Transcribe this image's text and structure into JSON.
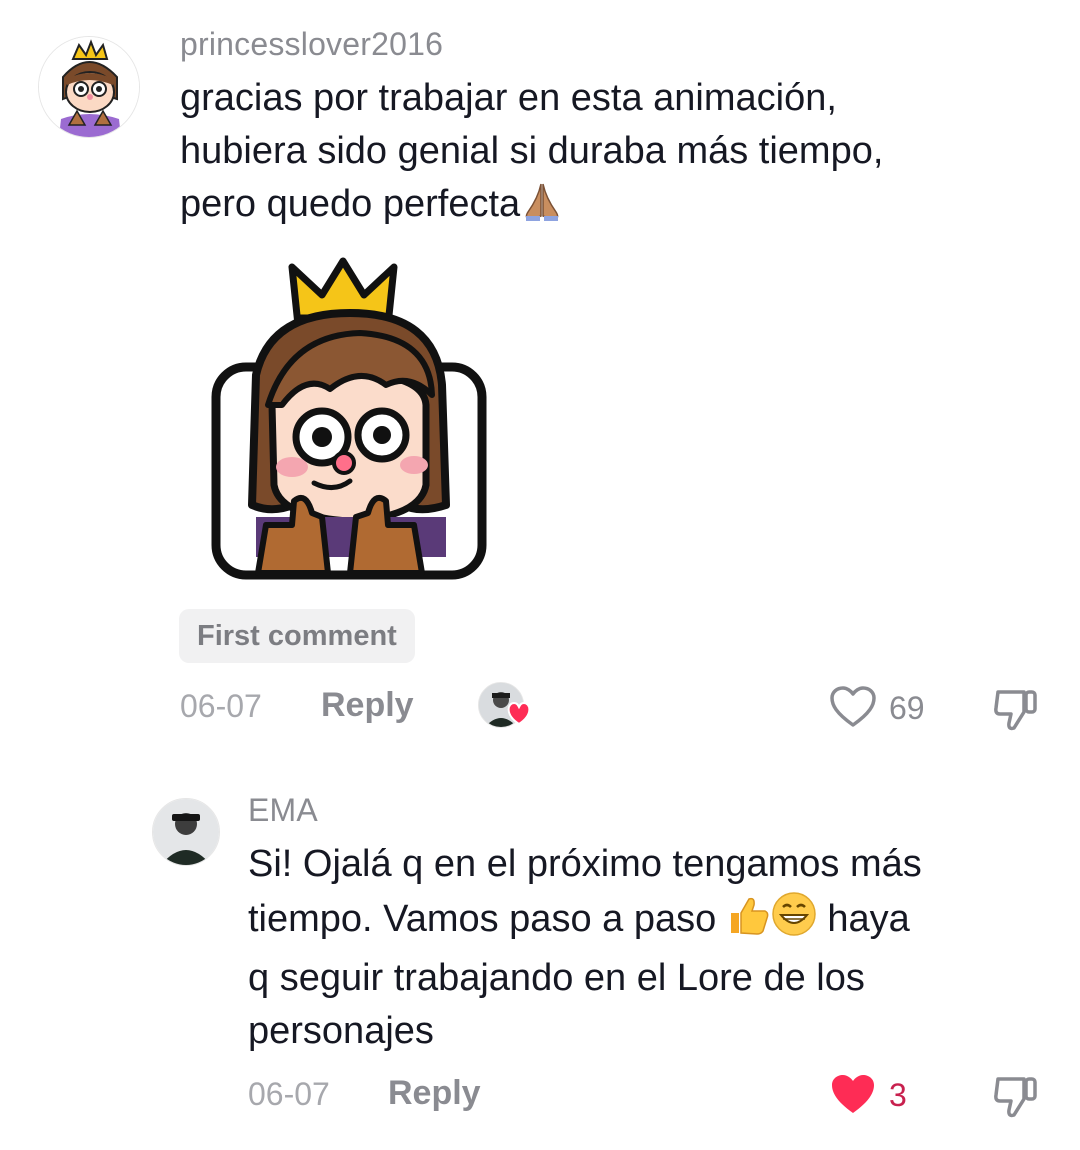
{
  "comments": [
    {
      "username": "princesslover2016",
      "text_line1": "gracias por trabajar en esta animación,",
      "text_line2": "hubiera sido genial si duraba más tiempo,",
      "text_line3": "pero quedo perfecta",
      "text_emoji": "pray-icon",
      "badge": "First comment",
      "date": "06-07",
      "reply_label": "Reply",
      "like_count": "69",
      "liked": false
    },
    {
      "username": "EMA",
      "text_line1": "Si! Ojalá q en el próximo tengamos más",
      "text_line2a": "tiempo. Vamos paso a paso ",
      "text_line2b": " haya",
      "text_line3": "q seguir trabajando en el Lore de los",
      "text_line4": "personajes",
      "text_emojis": [
        "thumbs-up-icon",
        "grin-icon"
      ],
      "date": "06-07",
      "reply_label": "Reply",
      "like_count": "3",
      "liked": true
    }
  ],
  "colors": {
    "text": "#161823",
    "muted": "#8a8b91",
    "like_red": "#fe2c55",
    "crown": "#f5c518",
    "hair": "#7a4a2a"
  }
}
